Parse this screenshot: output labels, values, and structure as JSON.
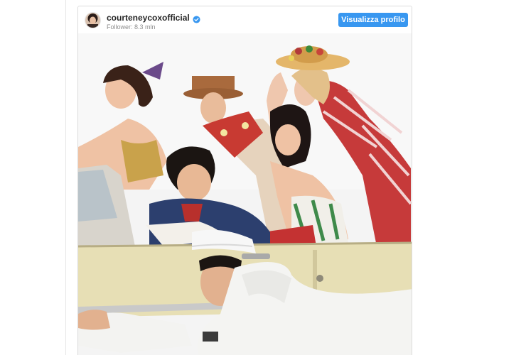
{
  "post": {
    "username": "courteneycoxofficial",
    "followers": "Follower: 8.3 mln",
    "profile_button_label": "Visualizza profilo",
    "verified_icon": "verified-badge-icon",
    "avatar_icon": "avatar"
  },
  "colors": {
    "accent": "#3897f0",
    "text": "#262626",
    "muted": "#8e8e8e",
    "border": "#dbdbdb"
  }
}
